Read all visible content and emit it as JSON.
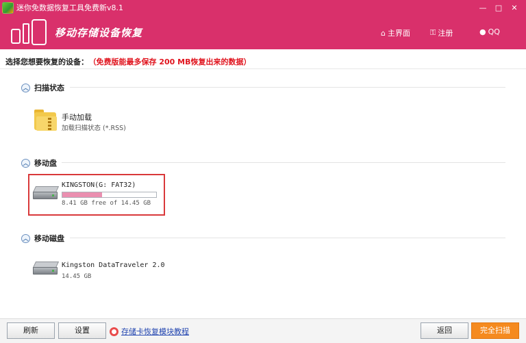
{
  "window": {
    "title": "迷你免数据恢复工具免费新v8.1",
    "minimize": "—",
    "maximize": "□",
    "close": "✕"
  },
  "header": {
    "title": "移动存储设备恢复",
    "nav": [
      {
        "label": "主界面",
        "icon": "home-icon",
        "glyph": "⌂"
      },
      {
        "label": "注册",
        "icon": "key-icon",
        "glyph": "⚿"
      },
      {
        "label": "QQ",
        "icon": "qq-icon",
        "glyph": "●"
      }
    ]
  },
  "prompt": {
    "label": "选择您想要恢复的设备：",
    "note": "（免费版能最多保存 200 MB恢复出来的数据）"
  },
  "sections": [
    {
      "title": "扫描状态",
      "items": [
        {
          "name": "手动加载",
          "detail": "加载扫描状态 (*.RSS)",
          "icon": "folder-icon"
        }
      ]
    },
    {
      "title": "移动盘",
      "items": [
        {
          "name": "KINGSTON(G: FAT32)",
          "detail": "8.41 GB free of 14.45 GB",
          "usage_fraction": 0.42,
          "selected": true,
          "icon": "usb-drive-icon"
        }
      ]
    },
    {
      "title": "移动磁盘",
      "items": [
        {
          "name": "Kingston DataTraveler 2.0",
          "detail": "14.45 GB",
          "icon": "disk-drive-icon"
        }
      ]
    }
  ],
  "footer": {
    "refresh": "刷新",
    "settings": "设置",
    "help_link": "存储卡恢复模块教程",
    "back": "返回",
    "full_scan": "完全扫描"
  },
  "colors": {
    "brand": "#d9306b",
    "selection_border": "#d9383a",
    "usage_fill": "#ea8fb0",
    "primary_button": "#f58a1f",
    "note_red": "#e0141e"
  }
}
